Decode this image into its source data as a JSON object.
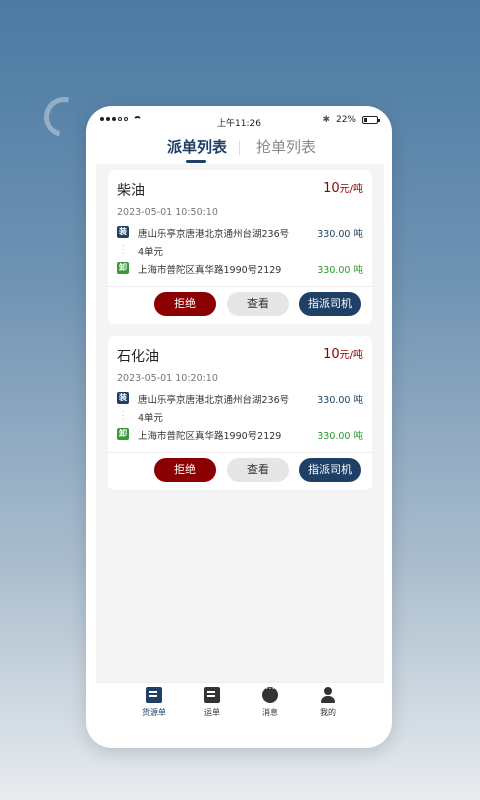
{
  "status_bar": {
    "time": "上午11:26",
    "battery": "22%",
    "battery_level": 0.22
  },
  "tabs": [
    {
      "label": "派单列表",
      "active": true
    },
    {
      "label": "抢单列表",
      "active": false
    }
  ],
  "cards": [
    {
      "title": "柴油",
      "price": "10",
      "price_unit": "元/吨",
      "time": "2023-05-01 10:50:10",
      "load_tag": "装",
      "load_address": "唐山乐亭京唐港北京通州台湖236号",
      "load_weight": "330.00 吨",
      "units": "4单元",
      "unload_tag": "卸",
      "unload_address": "上海市普陀区真华路1990号2129",
      "unload_weight": "330.00 吨",
      "buttons": {
        "reject": "拒绝",
        "view": "查看",
        "assign": "指派司机"
      }
    },
    {
      "title": "石化油",
      "price": "10",
      "price_unit": "元/吨",
      "time": "2023-05-01 10:20:10",
      "load_tag": "装",
      "load_address": "唐山乐亭京唐港北京通州台湖236号",
      "load_weight": "330.00 吨",
      "units": "4单元",
      "unload_tag": "卸",
      "unload_address": "上海市普陀区真华路1990号2129",
      "unload_weight": "330.00 吨",
      "buttons": {
        "reject": "拒绝",
        "view": "查看",
        "assign": "指派司机"
      }
    }
  ],
  "bottom_nav": [
    {
      "label": "货源单",
      "icon": "cargo-doc-icon",
      "active": true
    },
    {
      "label": "运单",
      "icon": "waybill-icon",
      "active": false
    },
    {
      "label": "消息",
      "icon": "chat-icon",
      "active": false
    },
    {
      "label": "我的",
      "icon": "user-icon",
      "active": false
    }
  ],
  "colors": {
    "primary": "#1e3f66",
    "danger": "#8b0000",
    "success": "#2a9a2a"
  }
}
